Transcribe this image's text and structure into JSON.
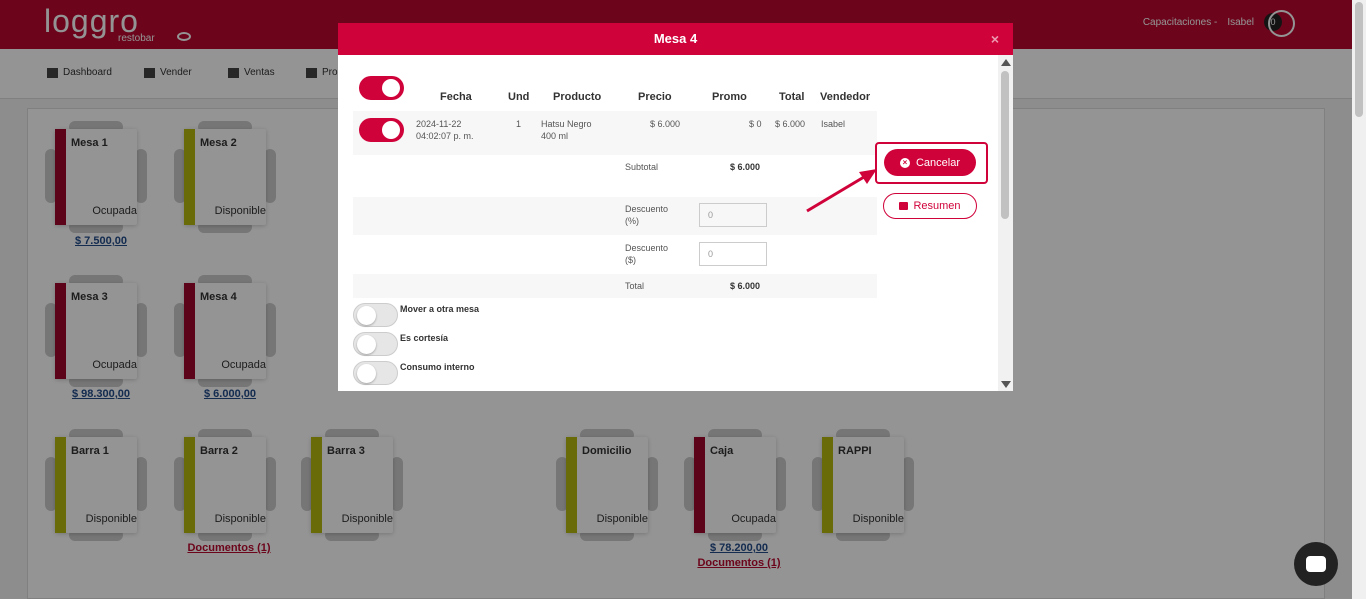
{
  "app": {
    "logo_text": "loggro",
    "logo_sub": "restobar"
  },
  "header": {
    "company": "Capacitaciones -",
    "user": "Isabel",
    "notifications": "0"
  },
  "nav": {
    "items": [
      "Dashboard",
      "Vender",
      "Ventas",
      "Pro"
    ]
  },
  "tables": [
    {
      "name": "Mesa 1",
      "status": "Ocupada",
      "color": "#a0062c",
      "amount": "$ 7.500,00"
    },
    {
      "name": "Mesa 2",
      "status": "Disponible",
      "color": "#b5b80f",
      "amount": ""
    },
    {
      "name": "Mesa 3",
      "status": "Ocupada",
      "color": "#a0062c",
      "amount": "$ 98.300,00"
    },
    {
      "name": "Mesa 4",
      "status": "Ocupada",
      "color": "#a0062c",
      "amount": "$ 6.000,00"
    },
    {
      "name": "Barra 1",
      "status": "Disponible",
      "color": "#b5b80f",
      "amount": ""
    },
    {
      "name": "Barra 2",
      "status": "Disponible",
      "color": "#b5b80f",
      "amount": "",
      "docs": "Documentos (1)"
    },
    {
      "name": "Barra 3",
      "status": "Disponible",
      "color": "#b5b80f",
      "amount": ""
    },
    {
      "name": "Domicilio",
      "status": "Disponible",
      "color": "#b5b80f",
      "amount": ""
    },
    {
      "name": "Caja",
      "status": "Ocupada",
      "color": "#a0062c",
      "amount": "$ 78.200,00",
      "docs": "Documentos (1)"
    },
    {
      "name": "RAPPI",
      "status": "Disponible",
      "color": "#b5b80f",
      "amount": ""
    }
  ],
  "modal": {
    "title": "Mesa 4",
    "close": "×",
    "columns": [
      "Fecha",
      "Und",
      "Producto",
      "Precio",
      "Promo",
      "Total",
      "Vendedor"
    ],
    "row": {
      "fecha": "2024-11-22 04:02:07 p. m.",
      "und": "1",
      "producto": "Hatsu Negro 400 ml",
      "precio": "$ 6.000",
      "promo": "$ 0",
      "total": "$ 6.000",
      "vendedor": "Isabel"
    },
    "subtotal_label": "Subtotal",
    "subtotal_value": "$ 6.000",
    "descuento_pct_label": "Descuento (%)",
    "descuento_pct_value": "0",
    "descuento_amt_label": "Descuento ($)",
    "descuento_amt_value": "0",
    "total_label": "Total",
    "total_value": "$ 6.000",
    "cancel_label": "Cancelar",
    "summary_label": "Resumen",
    "toggles": [
      "Mover a otra mesa",
      "Es cortesía",
      "Consumo interno"
    ]
  }
}
